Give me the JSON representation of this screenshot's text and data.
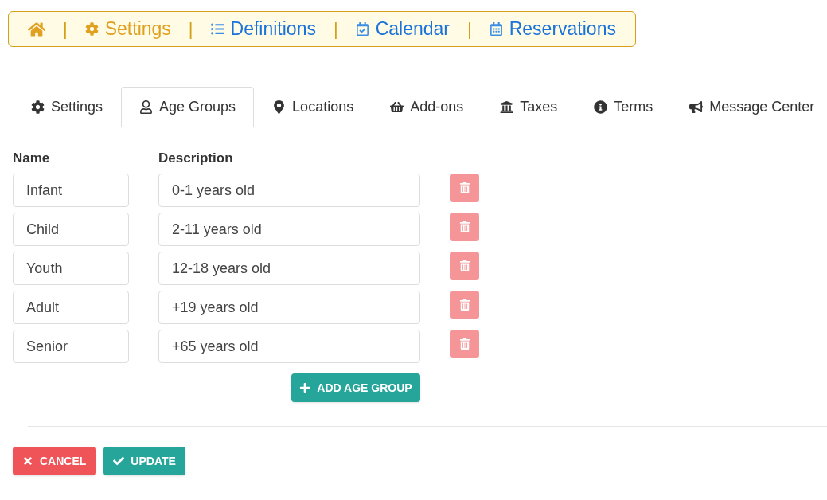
{
  "nav": [
    {
      "kind": "home",
      "selected": false
    },
    {
      "kind": "separator",
      "text": "|"
    },
    {
      "kind": "link",
      "label": "Settings",
      "selected": true
    },
    {
      "kind": "separator",
      "text": "|"
    },
    {
      "kind": "link",
      "label": "Definitions",
      "selected": false
    },
    {
      "kind": "separator",
      "text": "|"
    },
    {
      "kind": "link",
      "label": "Calendar",
      "selected": false
    },
    {
      "kind": "separator",
      "text": "|"
    },
    {
      "kind": "link",
      "label": "Reservations",
      "selected": false
    }
  ],
  "tabs": [
    {
      "label": "Settings",
      "selected": false
    },
    {
      "label": "Age Groups",
      "selected": true
    },
    {
      "label": "Locations",
      "selected": false
    },
    {
      "label": "Add-ons",
      "selected": false
    },
    {
      "label": "Taxes",
      "selected": false
    },
    {
      "label": "Terms",
      "selected": false
    },
    {
      "label": "Message Center",
      "selected": false
    }
  ],
  "columns": [
    "Name",
    "Description"
  ],
  "rows": [
    {
      "name": "Infant",
      "description": "0-1 years old"
    },
    {
      "name": "Child",
      "description": "2-11 years old"
    },
    {
      "name": "Youth",
      "description": "12-18 years old"
    },
    {
      "name": "Adult",
      "description": "+19 years old"
    },
    {
      "name": "Senior",
      "description": "+65 years old"
    }
  ],
  "add_button": "ADD AGE GROUP",
  "cancel_button": "CANCEL",
  "update_button": "UPDATE"
}
